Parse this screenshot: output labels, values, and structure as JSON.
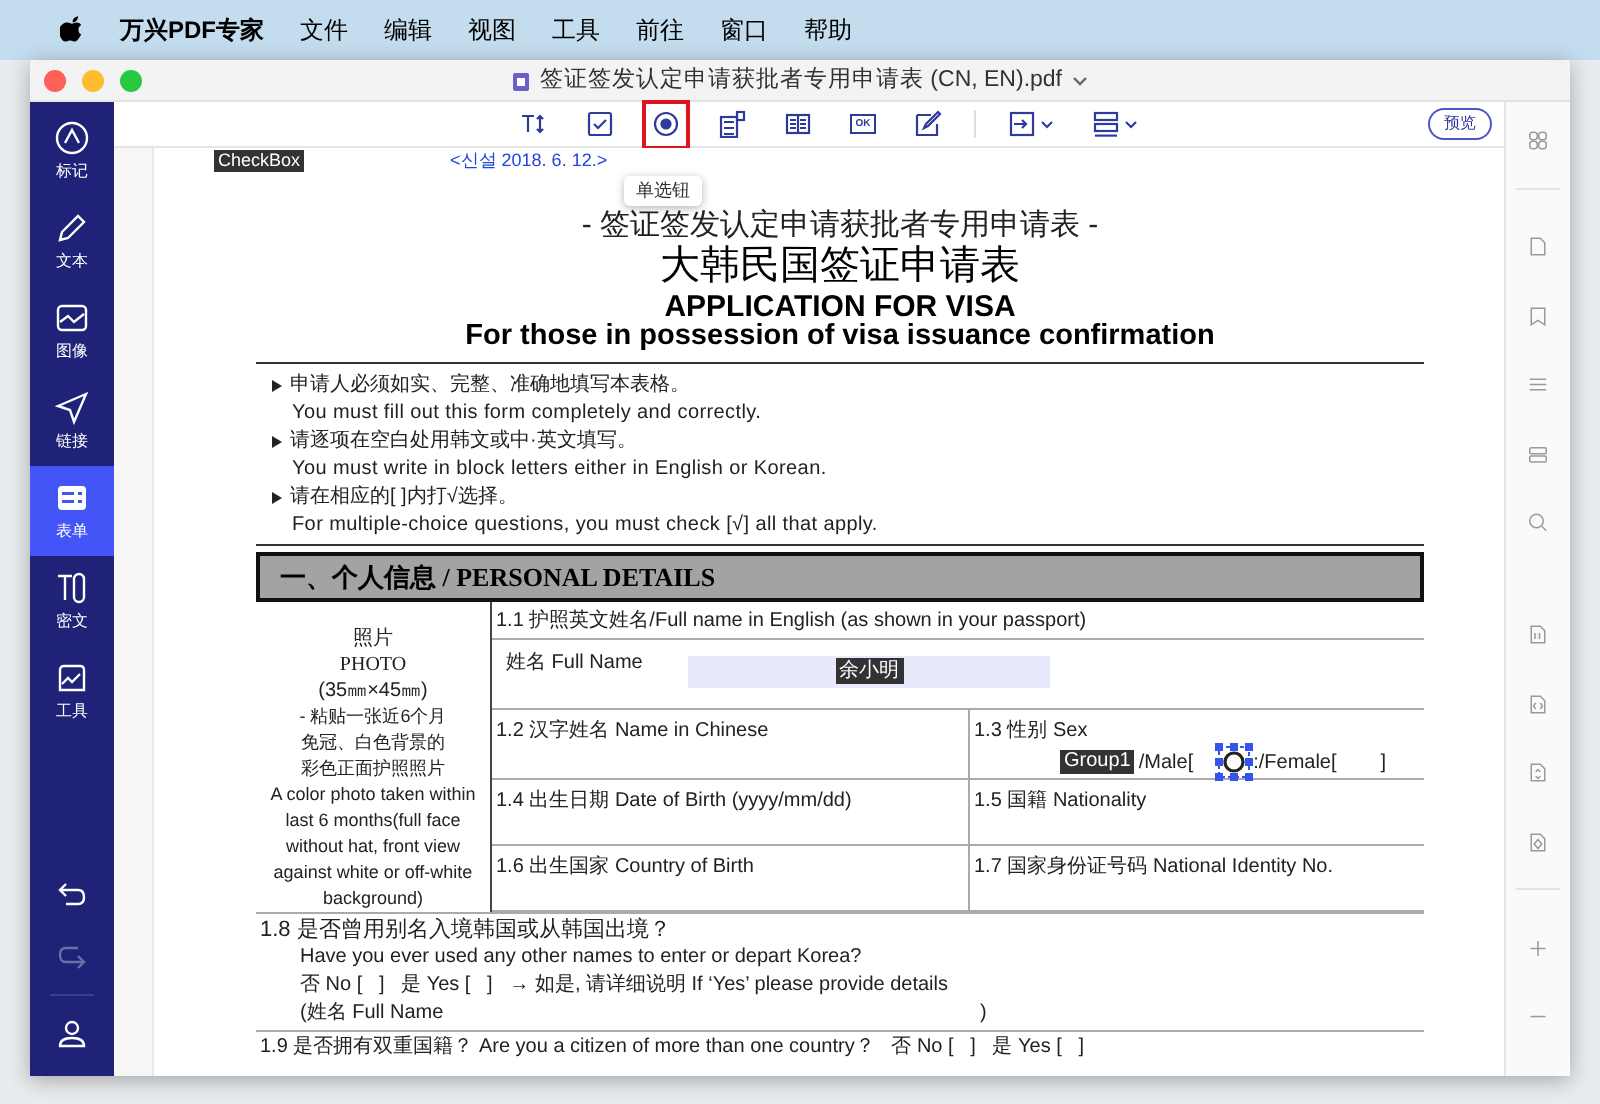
{
  "menubar": {
    "items": [
      "万兴PDF专家",
      "文件",
      "编辑",
      "视图",
      "工具",
      "前往",
      "窗口",
      "帮助"
    ]
  },
  "window": {
    "title": "签证签发认定申请获批者专用申请表 (CN, EN).pdf"
  },
  "left_sidebar": {
    "items": [
      {
        "kind": "markup",
        "label": "标记",
        "selected": false
      },
      {
        "kind": "text",
        "label": "文本",
        "selected": false
      },
      {
        "kind": "image",
        "label": "图像",
        "selected": false
      },
      {
        "kind": "link",
        "label": "链接",
        "selected": false
      },
      {
        "kind": "form",
        "label": "表单",
        "selected": true
      },
      {
        "kind": "redact",
        "label": "密文",
        "selected": false
      },
      {
        "kind": "tools",
        "label": "工具",
        "selected": false
      }
    ]
  },
  "toolbar": {
    "tools": [
      {
        "kind": "text-field",
        "selected": false
      },
      {
        "kind": "checkbox",
        "selected": false
      },
      {
        "kind": "radio",
        "selected": true
      },
      {
        "kind": "list-box",
        "selected": false
      },
      {
        "kind": "combo-box",
        "selected": false
      },
      {
        "kind": "button",
        "label": "OK",
        "selected": false
      },
      {
        "kind": "signature",
        "selected": false
      },
      {
        "kind": "align",
        "selected": false
      },
      {
        "kind": "distribute",
        "selected": false
      }
    ],
    "tooltip": "单选钮",
    "preview_button": "预览"
  },
  "document": {
    "header": {
      "badge": "CheckBox",
      "note": "<신설 2018. 6. 12.>"
    },
    "subtitle": "- 签证签发认定申请获批者专用申请表 -",
    "title_cn": "大韩民国签证申请表",
    "title_en": "APPLICATION FOR VISA",
    "subtitle_en": "For those in possession of visa issuance confirmation",
    "instructions": [
      {
        "cn": "申请人必须如实、完整、准确地填写本表格。",
        "en": "You must fill out this form completely and correctly."
      },
      {
        "cn": "请逐项在空白处用韩文或中·英文填写。",
        "en": "You must write in block letters either in English or Korean."
      },
      {
        "cn": "请在相应的[  ]内打√选择。",
        "en": "For multiple-choice questions, you must check [√] all that apply."
      }
    ],
    "section": "一、个人信息 / PERSONAL DETAILS",
    "photo": {
      "title_cn": "照片",
      "title_en": "PHOTO",
      "size": "(35㎜×45㎜)",
      "lines_cn": [
        "- 粘贴一张近6个月",
        "免冠、白色背景的",
        "彩色正面护照照片"
      ],
      "note_en": "A color photo taken within last 6 months(full face without hat, front view against white or off-white background)"
    },
    "full_name": {
      "label": "1.1 护照英文姓名/Full name in English (as shown in your passport)",
      "field_label": "姓名 Full Name",
      "value": "余小明"
    },
    "chinese_name": "1.2 汉字姓名 Name in Chinese",
    "sex": {
      "label": "1.3 性别 Sex",
      "group": "Group1",
      "male": "/Male[",
      "female": ":/Female[",
      "close": "]",
      "radio_selected": true
    },
    "birth_date": "1.4 出生日期 Date of Birth (yyyy/mm/dd)",
    "nationality": "1.5 国籍 Nationality",
    "birth_country": "1.6 出生国家 Country of Birth",
    "national_id": "1.7 国家身份证号码 National Identity No.",
    "q18": {
      "title": "1.8 是否曾用别名入境韩国或从韩国出境？",
      "en": "Have you ever used any other names to enter or depart Korea?",
      "options": "否 No [   ]   是 Yes [   ]   → 如是, 请详细说明 If ‘Yes’ please provide details",
      "name_open": "(姓名 Full Name",
      "name_close": ")"
    },
    "q19": {
      "title": "1.9 是否拥有双重国籍？ Are you a citizen of more than one country？   否 No [   ]   是 Yes [   ]"
    }
  }
}
